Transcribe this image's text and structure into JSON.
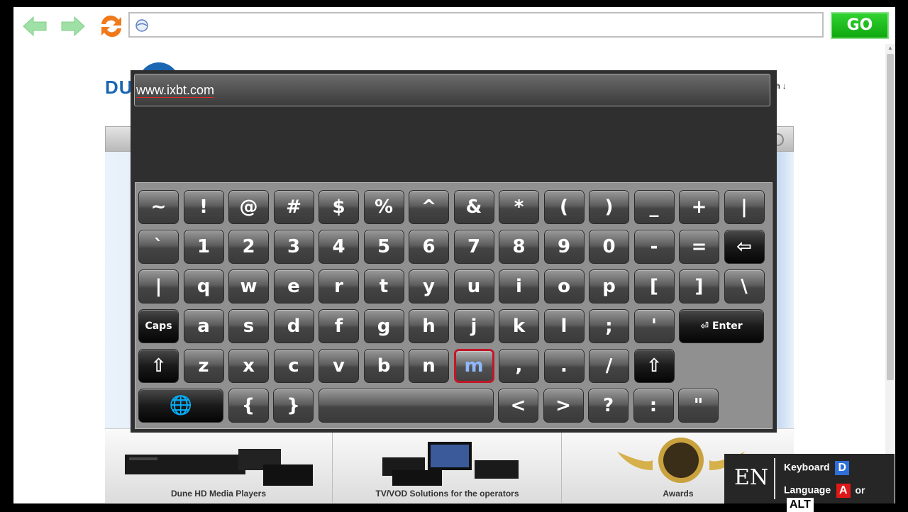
{
  "toolbar": {
    "back_icon": "arrow-left-icon",
    "forward_icon": "arrow-right-icon",
    "refresh_icon": "refresh-icon",
    "address_value": "",
    "go_label": "GO"
  },
  "page": {
    "logo_text": "DU",
    "language_peek": "sh ↓",
    "products": [
      {
        "label": "Dune HD Media Players"
      },
      {
        "label": "TV/VOD Solutions for the operators"
      },
      {
        "label": "Awards"
      }
    ]
  },
  "keyboard": {
    "input_value": "www.ixbt.com",
    "rows": [
      [
        "~",
        "!",
        "@",
        "#",
        "$",
        "%",
        "^",
        "&",
        "*",
        "(",
        ")",
        "_",
        "+",
        "|"
      ],
      [
        "`",
        "1",
        "2",
        "3",
        "4",
        "5",
        "6",
        "7",
        "8",
        "9",
        "0",
        "-",
        "=",
        "⇦"
      ],
      [
        "|",
        "q",
        "w",
        "e",
        "r",
        "t",
        "y",
        "u",
        "i",
        "o",
        "p",
        "[",
        "]",
        "\\"
      ],
      [
        "Caps",
        "a",
        "s",
        "d",
        "f",
        "g",
        "h",
        "j",
        "k",
        "l",
        ";",
        "'",
        "⏎ Enter"
      ],
      [
        "⇧",
        "z",
        "x",
        "c",
        "v",
        "b",
        "n",
        "m",
        ",",
        ".",
        "/",
        "⇧"
      ],
      [
        "🌐",
        "{",
        "}",
        " ",
        "<",
        ">",
        "?",
        ":",
        "\""
      ]
    ],
    "focused_key": "m"
  },
  "language_panel": {
    "code": "EN",
    "keyboard_label": "Keyboard",
    "keyboard_key": "D",
    "language_label": "Language",
    "language_key": "A",
    "or_label": "or",
    "alt_key": "ALT"
  },
  "colors": {
    "go_button": "#12b312",
    "focus_border": "#c0182a",
    "focus_text": "#8fb8ff",
    "badge_d": "#2f6fd8",
    "badge_a": "#e01818"
  }
}
